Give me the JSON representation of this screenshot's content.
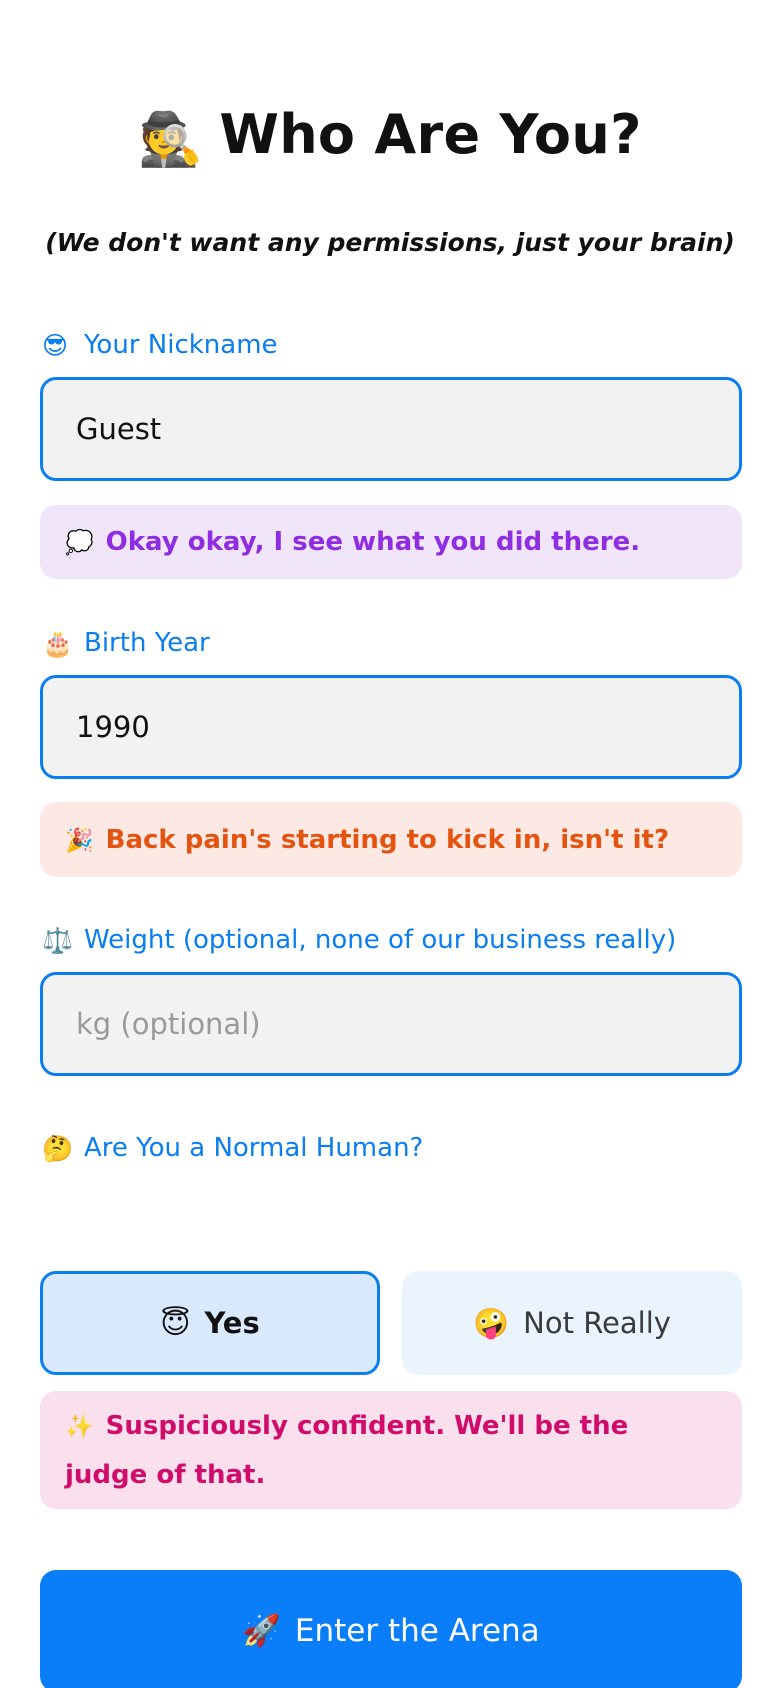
{
  "header": {
    "emoji": "🕵️",
    "title": "Who Are You?",
    "subtitle": "(We don't want any permissions, just your brain)"
  },
  "nickname": {
    "icon": "😎",
    "label": "Your Nickname",
    "value": "Guest",
    "note_icon": "💭",
    "note": "Okay okay, I see what you did there."
  },
  "birth_year": {
    "icon": "🎂",
    "label": "Birth Year",
    "value": "1990",
    "note_icon": "🎉",
    "note": "Back pain's starting to kick in, isn't it?"
  },
  "weight": {
    "icon": "⚖️",
    "label": "Weight (optional, none of our business really)",
    "value": "",
    "placeholder": "kg (optional)"
  },
  "normal_human": {
    "icon": "🤔",
    "label": "Are You a Normal Human?",
    "options": [
      {
        "icon": "😇",
        "label": "Yes",
        "selected": true
      },
      {
        "icon": "🤪",
        "label": "Not Really",
        "selected": false
      }
    ],
    "note_icon": "✨",
    "note": "Suspiciously confident. We'll be the judge of that."
  },
  "submit": {
    "icon": "🚀",
    "label": "Enter the Arena"
  },
  "colors": {
    "accent": "#0a7ef0",
    "field_background": "#f2f2f2",
    "nickname_note_background": "#f1e5fa",
    "nickname_note_text": "#8f2de2",
    "birth_note_background": "#fde9e4",
    "birth_note_text": "#e45410",
    "human_note_background": "#f9e0ec",
    "human_note_text": "#d10b6a",
    "selected_option_background": "#d9eafe",
    "option_background": "#e9f4fe",
    "submit_background": "#0a7ef9"
  }
}
